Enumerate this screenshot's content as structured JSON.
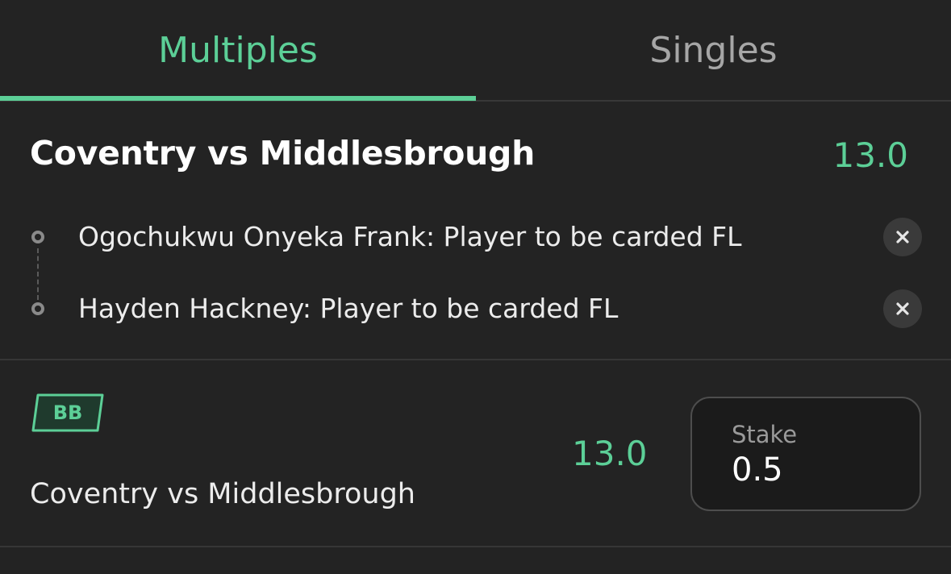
{
  "tabs": {
    "multiples": "Multiples",
    "singles": "Singles"
  },
  "match": {
    "title": "Coventry vs Middlesbrough",
    "odds": "13.0"
  },
  "selections": [
    {
      "label": "Ogochukwu Onyeka Frank: Player to be carded FL"
    },
    {
      "label": "Hayden Hackney: Player to be carded FL"
    }
  ],
  "bet": {
    "badge": "BB",
    "match": "Coventry vs Middlesbrough",
    "odds": "13.0",
    "stake_label": "Stake",
    "stake_value": "0.5"
  },
  "colors": {
    "accent": "#5ccf97",
    "background": "#232323",
    "inactive_tab": "#a6a6a6"
  },
  "icons": {
    "remove": "close-icon",
    "timeline": "timeline-dot-icon",
    "badge": "bet-builder-badge"
  }
}
